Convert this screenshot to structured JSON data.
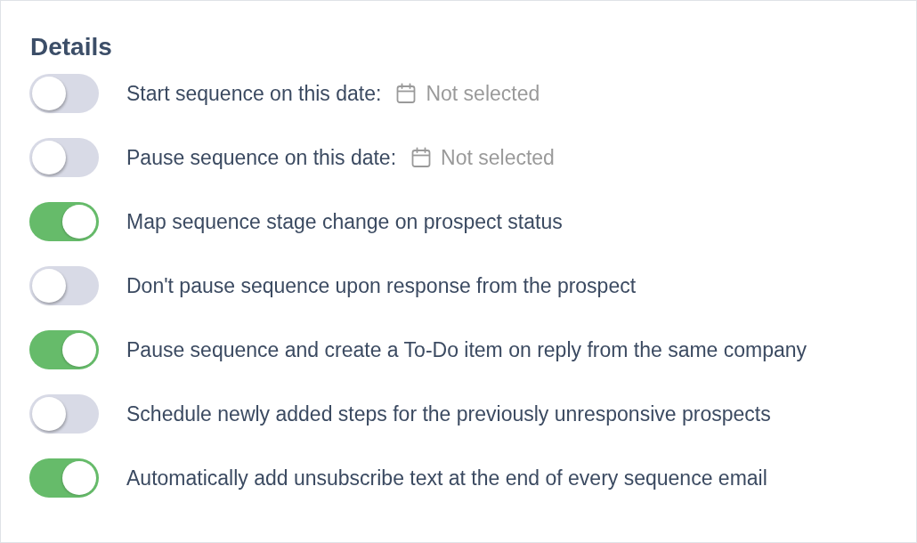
{
  "section": {
    "title": "Details"
  },
  "settings": [
    {
      "kind": "date",
      "label": "Start sequence on this date:",
      "on": false,
      "date_value": "Not selected"
    },
    {
      "kind": "date",
      "label": "Pause sequence on this date:",
      "on": false,
      "date_value": "Not selected"
    },
    {
      "kind": "plain",
      "label": "Map sequence stage change on prospect status",
      "on": true
    },
    {
      "kind": "plain",
      "label": "Don't pause sequence upon response from the prospect",
      "on": false
    },
    {
      "kind": "plain",
      "label": "Pause sequence and create a To-Do item on reply from the same company",
      "on": true
    },
    {
      "kind": "plain",
      "label": "Schedule newly added steps for the previously unresponsive prospects",
      "on": false
    },
    {
      "kind": "plain",
      "label": "Automatically add unsubscribe text at the end of every sequence email",
      "on": true
    }
  ]
}
